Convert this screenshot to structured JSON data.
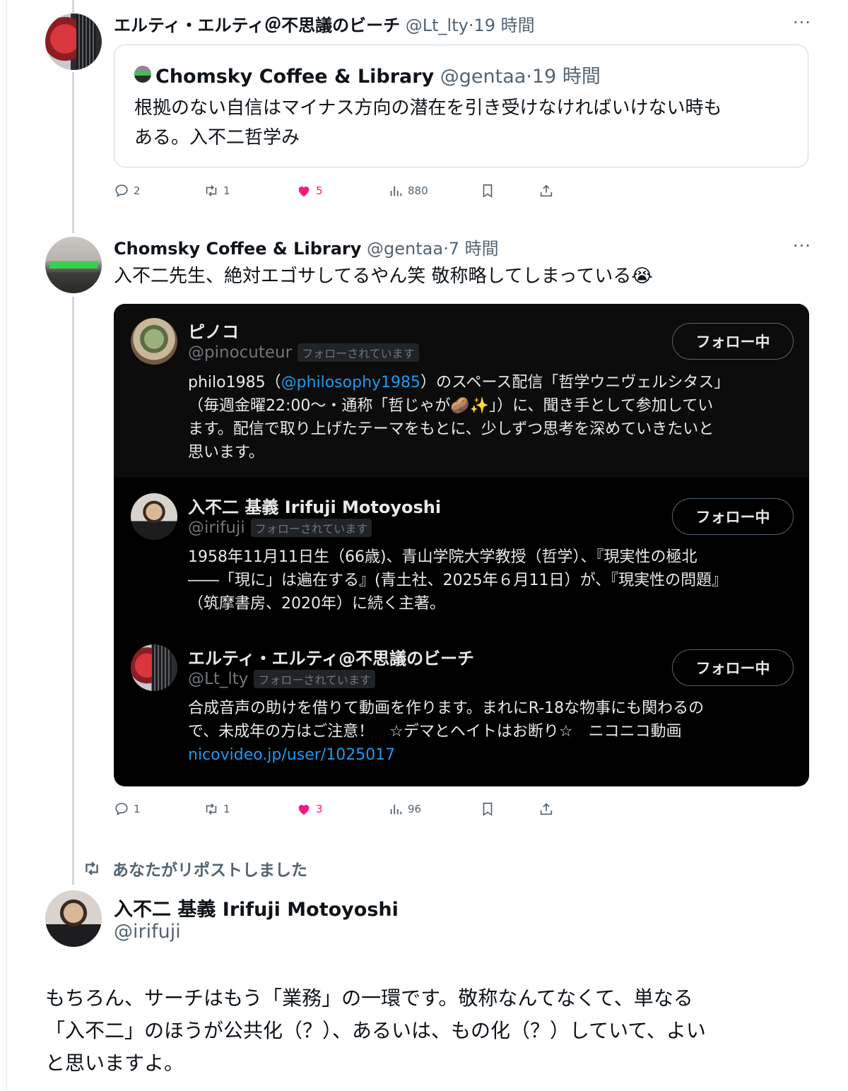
{
  "tweet1": {
    "name": "エルティ・エルティ＠不思議のビーチ",
    "handle": "@Lt_lty",
    "time": "·19 時間",
    "more_icon": "more-icon",
    "quote": {
      "name": "Chomsky Coffee & Library",
      "handle": "@gentaa",
      "time": "·19 時間",
      "text_line1": "根拠のない自信はマイナス方向の潜在を引き受けなければいけない時も",
      "text_line2": "ある。入不二哲学み"
    },
    "actions": {
      "replies": "2",
      "reposts": "1",
      "likes": "5",
      "views": "880"
    }
  },
  "tweet2": {
    "name": "Chomsky Coffee & Library",
    "handle": "@gentaa",
    "time": "·7 時間",
    "text": "入不二先生、絶対エゴサしてるやん笑 敬称略してしまっている😭",
    "card": {
      "users": [
        {
          "name": "ピノコ",
          "handle": "@pinocuteur",
          "badge": "フォローされています",
          "button": "フォロー中",
          "bio_part1": "philo1985（",
          "bio_link": "@philosophy1985",
          "bio_part2": "）のスペース配信「哲学ウニヴェルシタス」",
          "bio_line2": "（毎週金曜22:00〜・通称「哲じゃが🥔✨」）に、聞き手として参加してい",
          "bio_line3": "ます。配信で取り上げたテーマをもとに、少しずつ思考を深めていきたいと",
          "bio_line4": "思います。"
        },
        {
          "name": "入不二 基義 Irifuji Motoyoshi",
          "handle": "@irifuji",
          "badge": "フォローされています",
          "button": "フォロー中",
          "bio_line1": "1958年11月11日生（66歳)、青山学院大学教授（哲学）、『現実性の極北",
          "bio_line2": "――「現に」は遍在する』(青土社、2025年６月11日）が、『現実性の問題』",
          "bio_line3": "（筑摩書房、2020年）に続く主著。"
        },
        {
          "name": "エルティ・エルティ@不思議のビーチ",
          "handle": "@Lt_lty",
          "badge": "フォローされています",
          "button": "フォロー中",
          "bio_line1": "合成音声の助けを借りて動画を作ります。まれにR-18な物事にも関わるの",
          "bio_line2": "で、未成年の方はご注意！　☆デマとヘイトはお断り☆　ニコニコ動画",
          "bio_link": "nicovideo.jp/user/1025017"
        }
      ]
    },
    "actions": {
      "replies": "1",
      "reposts": "1",
      "likes": "3",
      "views": "96"
    }
  },
  "tweet3": {
    "repost_label": "あなたがリポストしました",
    "name": "入不二 基義 Irifuji Motoyoshi",
    "handle": "@irifuji",
    "text_line1": "もちろん、サーチはもう「業務」の一環です。敬称なんてなくて、単なる",
    "text_line2": "「入不二」のほうが公共化（？）、あるいは、もの化（？）していて、よい",
    "text_line3": "と思いますよ。"
  },
  "colors": {
    "like": "#f91880",
    "link": "#1d9bf0",
    "secondary": "#536471"
  }
}
